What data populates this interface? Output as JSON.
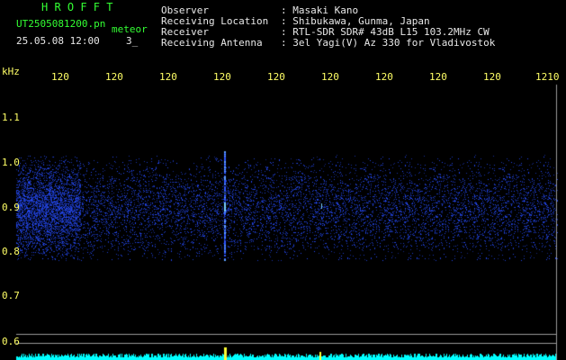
{
  "header": {
    "app_title": "H R O F F T",
    "filename": "UT2505081200.pn",
    "tag": "meteor",
    "datetime": "25.05.08 12:00",
    "count": "3_",
    "info_labels": [
      "Observer",
      "Receiving Location",
      "Receiver",
      "Receiving Antenna"
    ],
    "info_values": [
      ": Masaki Kano",
      ": Shibukawa, Gunma, Japan",
      ": RTL-SDR SDR# 43dB L15 103.2MHz CW",
      ": 3el Yagi(V) Az 330 for Vladivostok"
    ]
  },
  "axes": {
    "y_unit": "kHz",
    "y_ticks": [
      "1.1",
      "1.0",
      "0.9",
      "0.8",
      "0.7",
      "0.6"
    ],
    "x_ticks": [
      "120",
      "120",
      "120",
      "120",
      "120",
      "120",
      "120",
      "120",
      "120",
      "1210"
    ]
  },
  "colors": {
    "grid_line": "#9a9a9a",
    "signal": "#2f56ff",
    "spectrum": "#00ffff",
    "header_green": "#33ff33",
    "text_yellow": "#ffff66"
  }
}
